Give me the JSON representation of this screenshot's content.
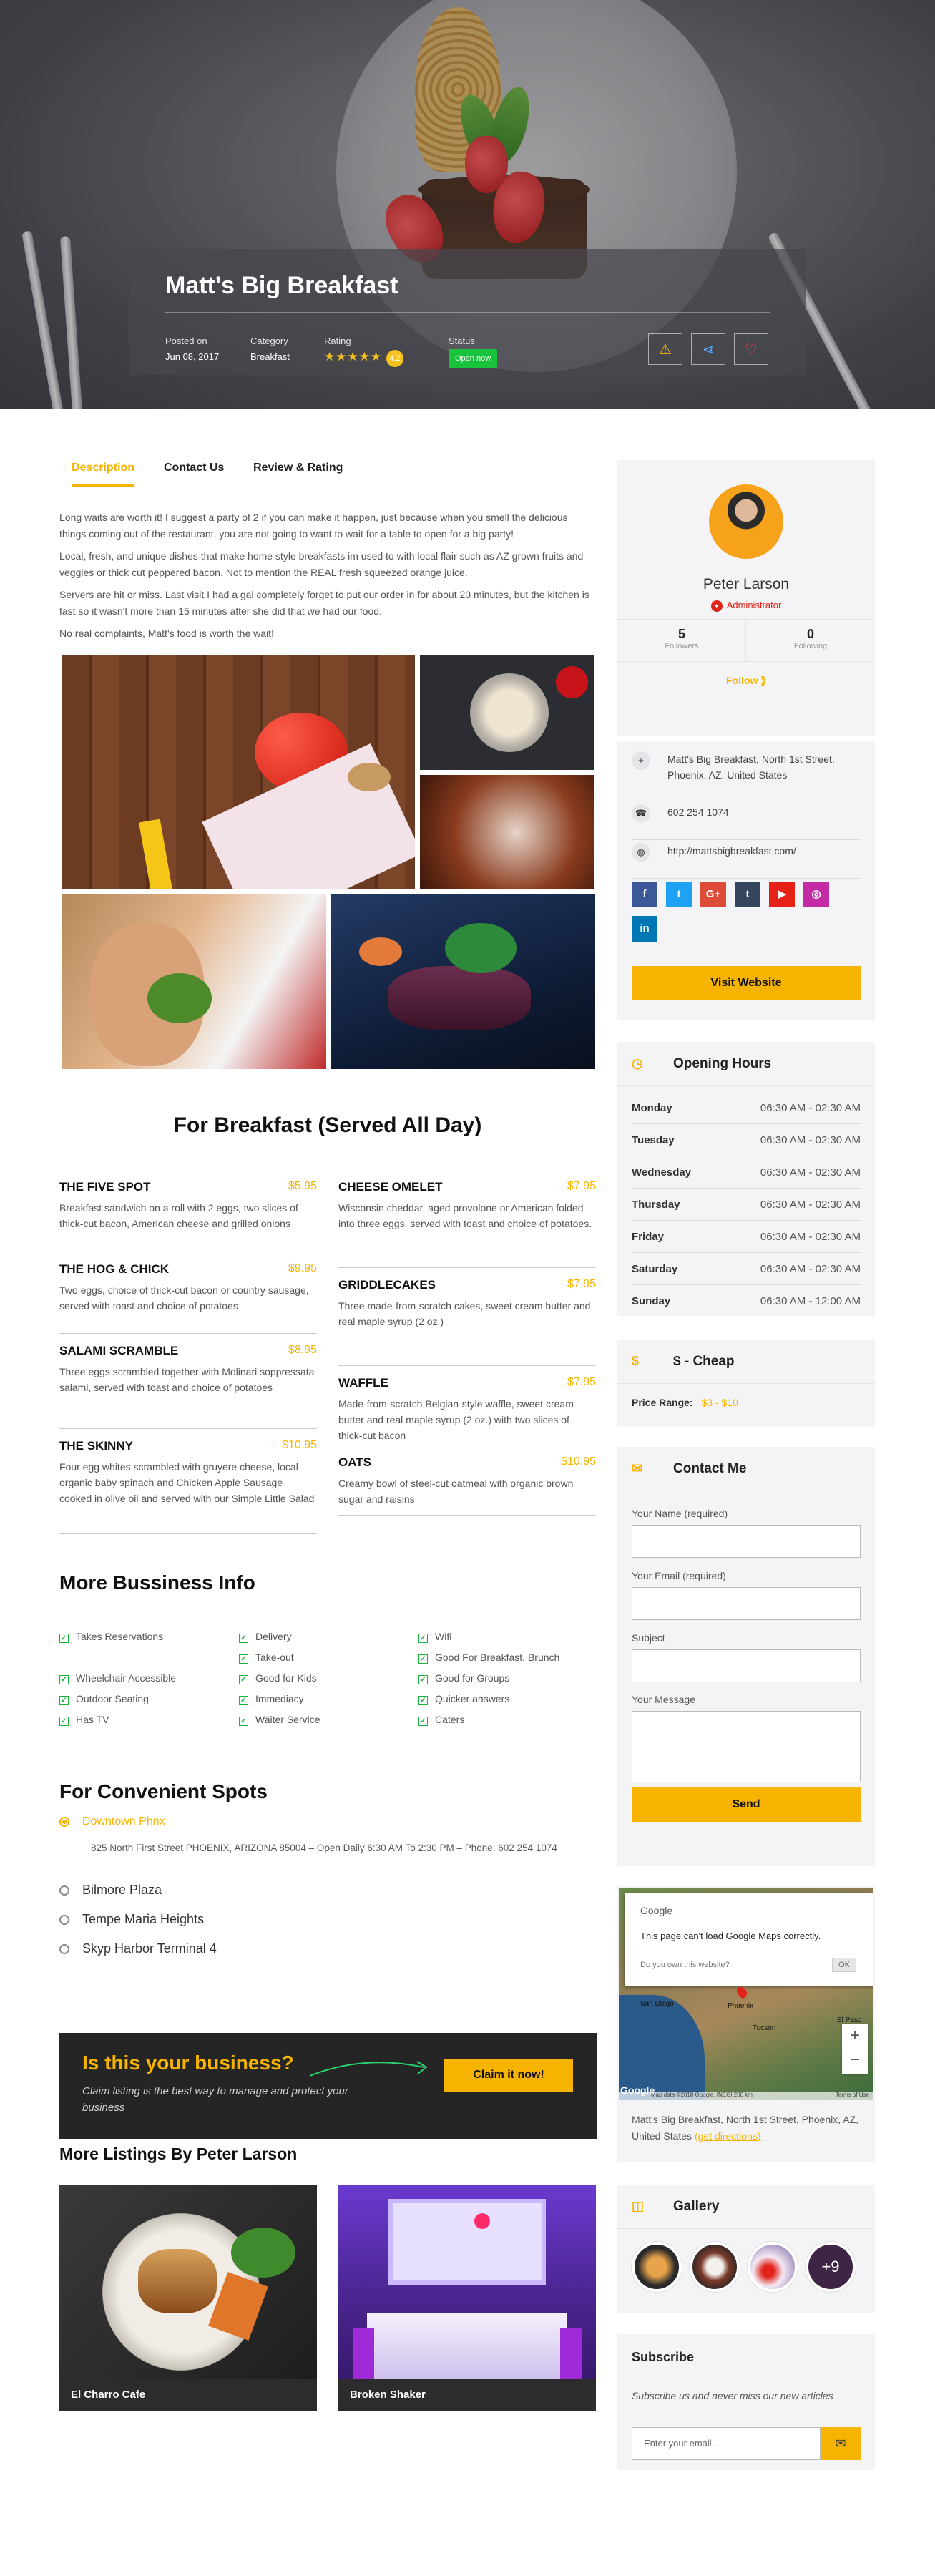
{
  "hero": {
    "title": "Matt's Big Breakfast",
    "posted_label": "Posted on",
    "posted_value": "Jun 08, 2017",
    "category_label": "Category",
    "category_value": "Breakfast",
    "rating_label": "Rating",
    "rating_stars": "★★★★★",
    "rating_value": "4.2",
    "rating": 4.2,
    "status_label": "Status",
    "status_value": "Open now",
    "report_icon": "warning-icon",
    "share_icon": "share-icon",
    "fav_icon": "heart-icon"
  },
  "tabs": [
    "Description",
    "Contact Us",
    "Review & Rating"
  ],
  "description": [
    "Long waits are worth it! I suggest a party of 2 if you can make it happen, just because when you smell the delicious things coming out of the restaurant, you are not going to want to wait for a table to open for a big party!",
    "Local, fresh, and unique dishes that make home style breakfasts im used to with local flair such as AZ grown fruits and veggies or thick cut peppered bacon. Not to mention the REAL fresh squeezed orange juice.",
    "Servers are hit or miss. Last visit I had a gal completely forget to put our order in for about 20 minutes, but the kitchen is fast so it wasn't more than 15 minutes after she did that we had our food.",
    "No real complaints, Matt's food is worth the wait!"
  ],
  "menu": {
    "title": "For Breakfast (Served All Day)",
    "left": [
      {
        "name": "THE FIVE SPOT",
        "price": "$5.95",
        "desc": "Breakfast sandwich on a roll with 2 eggs, two slices of thick-cut bacon, American cheese and grilled onions"
      },
      {
        "name": "THE HOG & CHICK",
        "price": "$9.95",
        "desc": "Two eggs, choice of thick-cut bacon or country sausage, served with toast and choice of potatoes"
      },
      {
        "name": "SALAMI SCRAMBLE",
        "price": "$8.95",
        "desc": "Three eggs scrambled together with Molinari soppressata salami, served with toast and choice of potatoes"
      },
      {
        "name": "THE SKINNY",
        "price": "$10.95",
        "desc": "Four egg whites scrambled with gruyere cheese, local organic baby spinach and Chicken Apple Sausage cooked in olive oil and served with our Simple Little Salad"
      }
    ],
    "right": [
      {
        "name": "CHEESE OMELET",
        "price": "$7.95",
        "desc": "Wisconsin cheddar, aged provolone or American folded into three eggs, served with toast and choice of potatoes."
      },
      {
        "name": "GRIDDLECAKES",
        "price": "$7.95",
        "desc": "Three made-from-scratch cakes, sweet cream butter and real maple syrup (2 oz.)"
      },
      {
        "name": "WAFFLE",
        "price": "$7.95",
        "desc": "Made-from-scratch Belgian-style waffle, sweet cream butter and real maple syrup (2 oz.) with two slices of thick-cut bacon"
      },
      {
        "name": "OATS",
        "price": "$10.95",
        "desc": "Creamy bowl of steel-cut oatmeal with organic brown sugar and raisins"
      }
    ]
  },
  "business_info": {
    "title": "More Bussiness Info",
    "col1": [
      "Takes Reservations",
      "",
      "Wheelchair Accessible",
      "Outdoor Seating",
      "Has TV"
    ],
    "col2": [
      "Delivery",
      "Take-out",
      "Good for Kids",
      "Immediacy",
      "Waiter Service"
    ],
    "col3": [
      "Wifi",
      "Good For Breakfast, Brunch",
      "Good for Groups",
      "Quicker answers",
      "Caters"
    ]
  },
  "spots": {
    "title": "For Convenient Spots",
    "selected": "Downtown Phnx",
    "selected_detail": "825 North First Street PHOENIX, ARIZONA 85004 – Open Daily 6:30 AM To 2:30 PM – Phone: 602 254 1074",
    "others": [
      "Bilmore Plaza",
      "Tempe Maria Heights",
      "Skyp Harbor Terminal 4"
    ]
  },
  "claim": {
    "title": "Is this your business?",
    "subtitle": "Claim listing is the best way to manage and protect your business",
    "button": "Claim it now!"
  },
  "more_listings": {
    "title": "More Listings By Peter Larson",
    "items": [
      "El Charro Cafe",
      "Broken Shaker"
    ]
  },
  "author": {
    "name": "Peter Larson",
    "role": "Administrator",
    "followers_count": "5",
    "followers_label": "Followers",
    "following_count": "0",
    "following_label": "Following",
    "follow_label": "Follow ⟫",
    "address": "Matt's Big Breakfast, North 1st Street, Phoenix, AZ, United States",
    "phone": "602 254 1074",
    "website": "http://mattsbigbreakfast.com/",
    "social": [
      "f",
      "t",
      "G+",
      "t",
      "▶",
      "◎",
      "in"
    ],
    "social_colors": [
      "#3b5998",
      "#1da1f2",
      "#dd4b39",
      "#35465c",
      "#e62117",
      "#c32aa3",
      "#0077b5"
    ],
    "visit_button": "Visit Website"
  },
  "hours": {
    "title": "Opening Hours",
    "rows": [
      {
        "day": "Monday",
        "time": "06:30 AM - 02:30 AM"
      },
      {
        "day": "Tuesday",
        "time": "06:30 AM - 02:30 AM"
      },
      {
        "day": "Wednesday",
        "time": "06:30 AM - 02:30 AM"
      },
      {
        "day": "Thursday",
        "time": "06:30 AM - 02:30 AM"
      },
      {
        "day": "Friday",
        "time": "06:30 AM - 02:30 AM"
      },
      {
        "day": "Saturday",
        "time": "06:30 AM - 02:30 AM"
      },
      {
        "day": "Sunday",
        "time": "06:30 AM - 12:00 AM"
      }
    ]
  },
  "price": {
    "title": "$ - Cheap",
    "label": "Price Range:",
    "value": "$3 - $10"
  },
  "contact": {
    "title": "Contact Me",
    "name_label": "Your Name (required)",
    "email_label": "Your Email (required)",
    "subject_label": "Subject",
    "message_label": "Your Message",
    "send": "Send"
  },
  "map": {
    "google": "Google",
    "error": "This page can't load Google Maps correctly.",
    "own": "Do you own this website?",
    "ok": "OK",
    "labels": [
      "San Diego",
      "Phoenix",
      "Tucson",
      "El Paso"
    ],
    "footer": "Map data ©2018 Google, INEGI  200 km",
    "terms": "Terms of Use",
    "address": "Matt's Big Breakfast, North 1st Street, Phoenix, AZ, United States",
    "directions": "(get directions)"
  },
  "gallery": {
    "title": "Gallery",
    "more": "+9"
  },
  "subscribe": {
    "title": "Subscribe",
    "text": "Subscribe us and never miss our new articles",
    "placeholder": "Enter your email..."
  },
  "colors": {
    "accent": "#f6b401",
    "open": "#18c23a",
    "dark": "#252525"
  }
}
